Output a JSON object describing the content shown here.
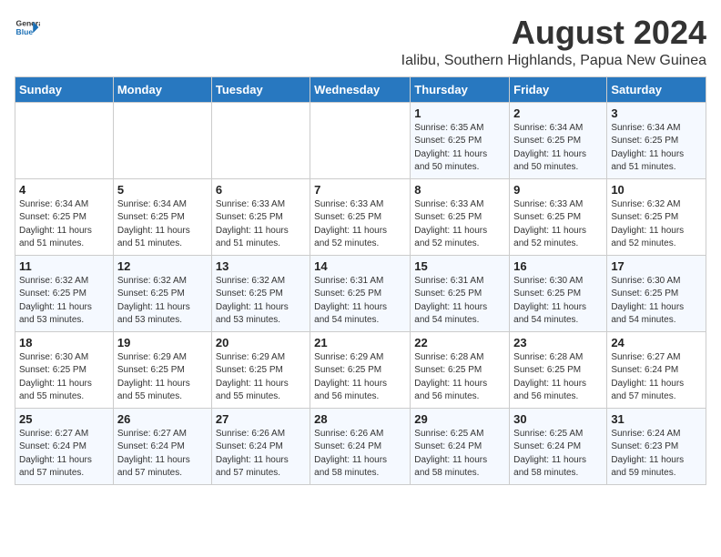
{
  "header": {
    "logo_general": "General",
    "logo_blue": "Blue",
    "main_title": "August 2024",
    "subtitle": "Ialibu, Southern Highlands, Papua New Guinea"
  },
  "weekdays": [
    "Sunday",
    "Monday",
    "Tuesday",
    "Wednesday",
    "Thursday",
    "Friday",
    "Saturday"
  ],
  "weeks": [
    [
      {
        "day": "",
        "info": ""
      },
      {
        "day": "",
        "info": ""
      },
      {
        "day": "",
        "info": ""
      },
      {
        "day": "",
        "info": ""
      },
      {
        "day": "1",
        "info": "Sunrise: 6:35 AM\nSunset: 6:25 PM\nDaylight: 11 hours\nand 50 minutes."
      },
      {
        "day": "2",
        "info": "Sunrise: 6:34 AM\nSunset: 6:25 PM\nDaylight: 11 hours\nand 50 minutes."
      },
      {
        "day": "3",
        "info": "Sunrise: 6:34 AM\nSunset: 6:25 PM\nDaylight: 11 hours\nand 51 minutes."
      }
    ],
    [
      {
        "day": "4",
        "info": "Sunrise: 6:34 AM\nSunset: 6:25 PM\nDaylight: 11 hours\nand 51 minutes."
      },
      {
        "day": "5",
        "info": "Sunrise: 6:34 AM\nSunset: 6:25 PM\nDaylight: 11 hours\nand 51 minutes."
      },
      {
        "day": "6",
        "info": "Sunrise: 6:33 AM\nSunset: 6:25 PM\nDaylight: 11 hours\nand 51 minutes."
      },
      {
        "day": "7",
        "info": "Sunrise: 6:33 AM\nSunset: 6:25 PM\nDaylight: 11 hours\nand 52 minutes."
      },
      {
        "day": "8",
        "info": "Sunrise: 6:33 AM\nSunset: 6:25 PM\nDaylight: 11 hours\nand 52 minutes."
      },
      {
        "day": "9",
        "info": "Sunrise: 6:33 AM\nSunset: 6:25 PM\nDaylight: 11 hours\nand 52 minutes."
      },
      {
        "day": "10",
        "info": "Sunrise: 6:32 AM\nSunset: 6:25 PM\nDaylight: 11 hours\nand 52 minutes."
      }
    ],
    [
      {
        "day": "11",
        "info": "Sunrise: 6:32 AM\nSunset: 6:25 PM\nDaylight: 11 hours\nand 53 minutes."
      },
      {
        "day": "12",
        "info": "Sunrise: 6:32 AM\nSunset: 6:25 PM\nDaylight: 11 hours\nand 53 minutes."
      },
      {
        "day": "13",
        "info": "Sunrise: 6:32 AM\nSunset: 6:25 PM\nDaylight: 11 hours\nand 53 minutes."
      },
      {
        "day": "14",
        "info": "Sunrise: 6:31 AM\nSunset: 6:25 PM\nDaylight: 11 hours\nand 54 minutes."
      },
      {
        "day": "15",
        "info": "Sunrise: 6:31 AM\nSunset: 6:25 PM\nDaylight: 11 hours\nand 54 minutes."
      },
      {
        "day": "16",
        "info": "Sunrise: 6:30 AM\nSunset: 6:25 PM\nDaylight: 11 hours\nand 54 minutes."
      },
      {
        "day": "17",
        "info": "Sunrise: 6:30 AM\nSunset: 6:25 PM\nDaylight: 11 hours\nand 54 minutes."
      }
    ],
    [
      {
        "day": "18",
        "info": "Sunrise: 6:30 AM\nSunset: 6:25 PM\nDaylight: 11 hours\nand 55 minutes."
      },
      {
        "day": "19",
        "info": "Sunrise: 6:29 AM\nSunset: 6:25 PM\nDaylight: 11 hours\nand 55 minutes."
      },
      {
        "day": "20",
        "info": "Sunrise: 6:29 AM\nSunset: 6:25 PM\nDaylight: 11 hours\nand 55 minutes."
      },
      {
        "day": "21",
        "info": "Sunrise: 6:29 AM\nSunset: 6:25 PM\nDaylight: 11 hours\nand 56 minutes."
      },
      {
        "day": "22",
        "info": "Sunrise: 6:28 AM\nSunset: 6:25 PM\nDaylight: 11 hours\nand 56 minutes."
      },
      {
        "day": "23",
        "info": "Sunrise: 6:28 AM\nSunset: 6:25 PM\nDaylight: 11 hours\nand 56 minutes."
      },
      {
        "day": "24",
        "info": "Sunrise: 6:27 AM\nSunset: 6:24 PM\nDaylight: 11 hours\nand 57 minutes."
      }
    ],
    [
      {
        "day": "25",
        "info": "Sunrise: 6:27 AM\nSunset: 6:24 PM\nDaylight: 11 hours\nand 57 minutes."
      },
      {
        "day": "26",
        "info": "Sunrise: 6:27 AM\nSunset: 6:24 PM\nDaylight: 11 hours\nand 57 minutes."
      },
      {
        "day": "27",
        "info": "Sunrise: 6:26 AM\nSunset: 6:24 PM\nDaylight: 11 hours\nand 57 minutes."
      },
      {
        "day": "28",
        "info": "Sunrise: 6:26 AM\nSunset: 6:24 PM\nDaylight: 11 hours\nand 58 minutes."
      },
      {
        "day": "29",
        "info": "Sunrise: 6:25 AM\nSunset: 6:24 PM\nDaylight: 11 hours\nand 58 minutes."
      },
      {
        "day": "30",
        "info": "Sunrise: 6:25 AM\nSunset: 6:24 PM\nDaylight: 11 hours\nand 58 minutes."
      },
      {
        "day": "31",
        "info": "Sunrise: 6:24 AM\nSunset: 6:23 PM\nDaylight: 11 hours\nand 59 minutes."
      }
    ]
  ]
}
